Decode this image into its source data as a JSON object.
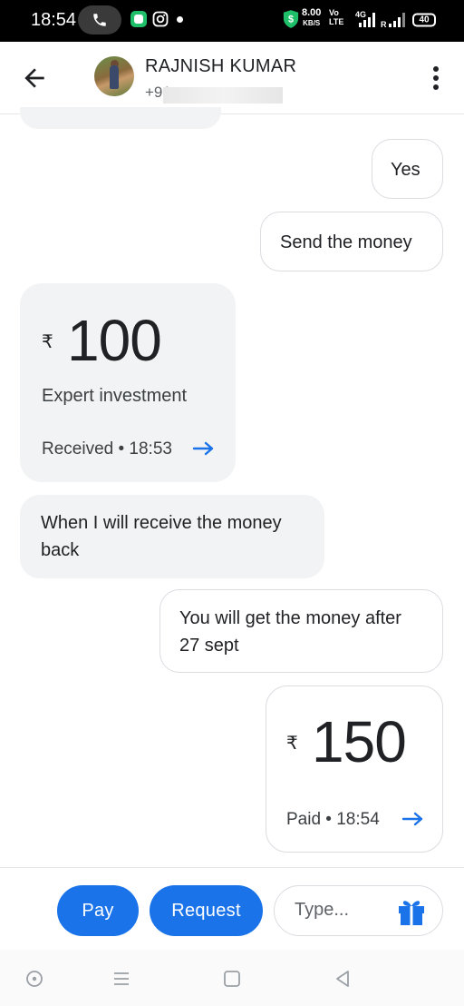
{
  "status_bar": {
    "time": "18:54",
    "net_speed_value": "8.00",
    "net_speed_unit": "KB/S",
    "volte_top": "Vo",
    "volte_bottom": "LTE",
    "network": "4G",
    "battery": "40",
    "icons": [
      "call-icon",
      "chat-app-icon",
      "instagram-icon",
      "shield-icon",
      "signal-icon",
      "battery-icon"
    ]
  },
  "header": {
    "contact_name": "RAJNISH KUMAR",
    "contact_phone": "+91",
    "icons": [
      "back-arrow-icon",
      "avatar",
      "more-vert-icon"
    ]
  },
  "messages": [
    {
      "direction": "outgoing",
      "text": "Yes"
    },
    {
      "direction": "outgoing",
      "text": "Send the money"
    },
    {
      "type": "payment",
      "direction": "incoming",
      "currency": "₹",
      "amount": "100",
      "note": "Expert investment",
      "status": "Received • 18:53"
    },
    {
      "direction": "incoming",
      "text": "When I will receive  the money back"
    },
    {
      "direction": "outgoing",
      "text": "You will get the money after 27 sept"
    },
    {
      "type": "payment",
      "direction": "outgoing",
      "currency": "₹",
      "amount": "150",
      "status": "Paid • 18:54"
    }
  ],
  "composer": {
    "pay_label": "Pay",
    "request_label": "Request",
    "input_placeholder": "Type...",
    "input_value": ""
  },
  "nav": {
    "icons": [
      "assistant-icon",
      "recents-icon",
      "home-icon",
      "back-icon"
    ]
  },
  "colors": {
    "accent": "#1a73e8",
    "incoming_bubble": "#f1f3f4",
    "outgoing_border": "#dadce0"
  }
}
